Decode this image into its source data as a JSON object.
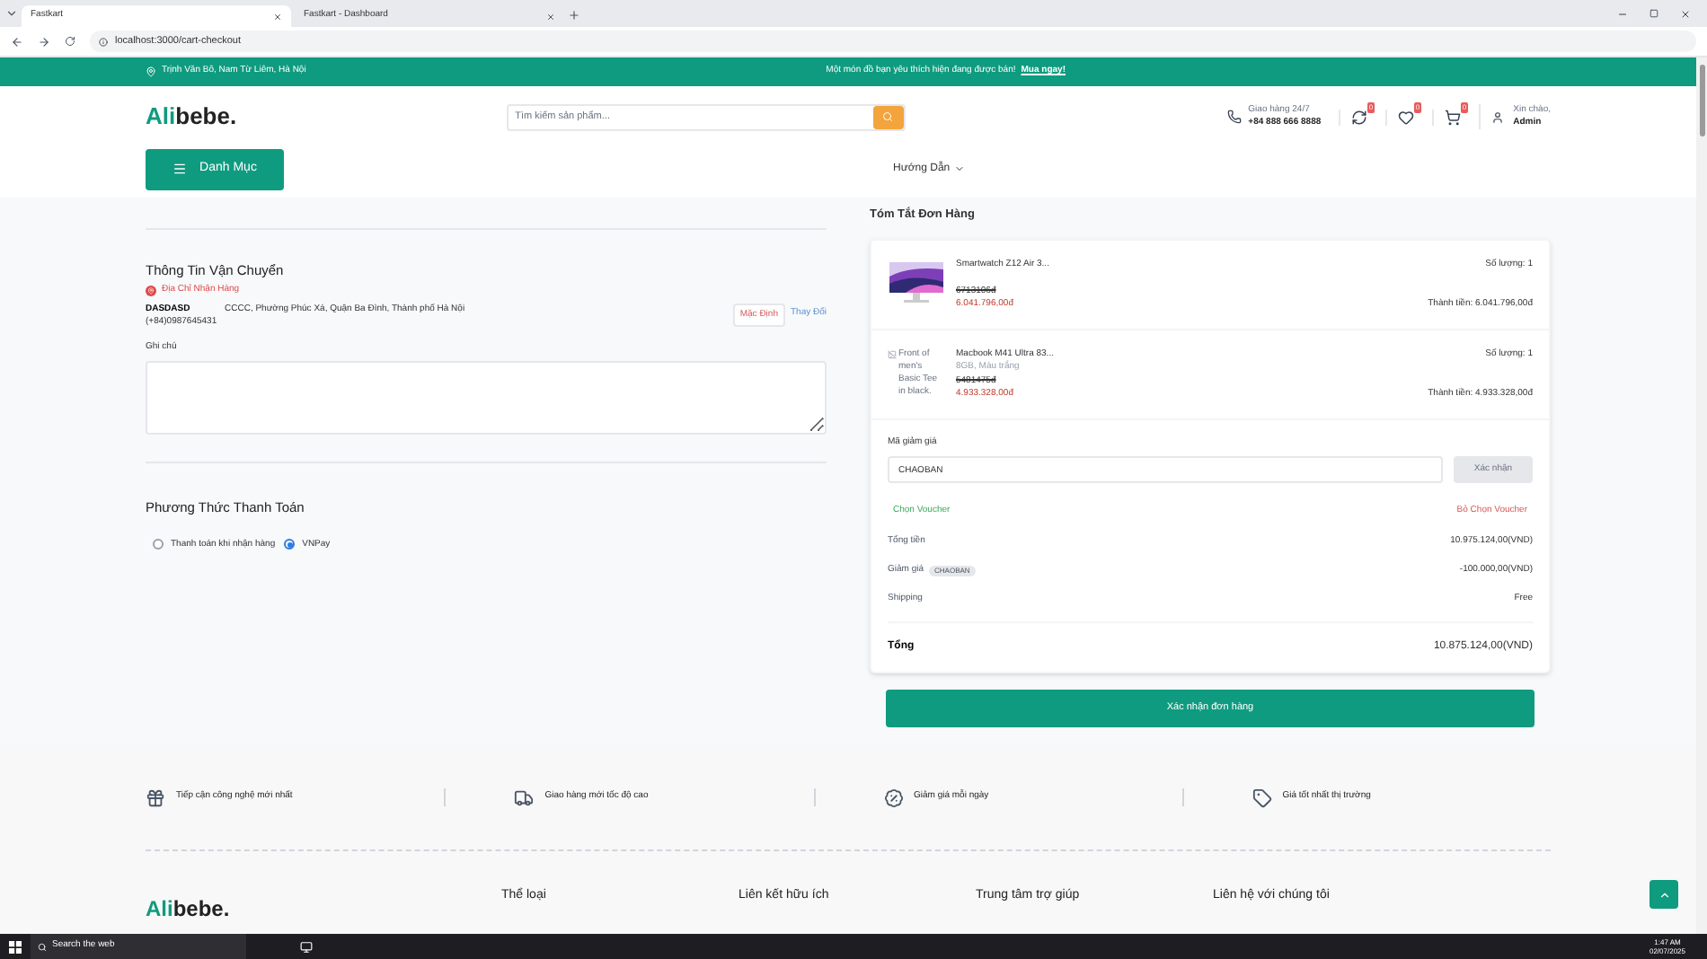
{
  "browser": {
    "tabs": [
      {
        "title": "Fastkart",
        "selected": true
      },
      {
        "title": "Fastkart - Dashboard",
        "selected": false
      }
    ],
    "url": "localhost:3000/cart-checkout"
  },
  "topbar": {
    "address": "Trịnh Văn Bô, Nam Từ Liêm, Hà Nội",
    "promo": "Một món đồ bạn yêu thích hiện đang được bán!",
    "promo_link": "Mua ngay!"
  },
  "header": {
    "logo_first": "Ali",
    "logo_second": "bebe.",
    "search_placeholder": "Tìm kiếm sản phẩm...",
    "hotline_label": "Giao hàng 24/7",
    "hotline_number": "+84 888 666 8888",
    "badges": [
      "0",
      "0",
      "0"
    ],
    "greeting": "Xin chào,",
    "user": "Admin",
    "category_button": "Danh Mục",
    "nav": "Hướng Dẫn"
  },
  "shipping": {
    "title": "Thông Tin Vận Chuyển",
    "address_label": "Địa Chỉ Nhận Hàng",
    "name": "DASDASD",
    "address": "CCCC, Phường Phúc Xá, Quận Ba Đình, Thành phố Hà Nội",
    "phone": "(+84)0987645431",
    "default_badge": "Mặc Định",
    "change_link": "Thay Đổi",
    "note_label": "Ghi chú"
  },
  "payment": {
    "title": "Phương Thức Thanh Toán",
    "options": [
      {
        "label": "Thanh toán khi nhận hàng",
        "selected": false
      },
      {
        "label": "VNPay",
        "selected": true
      }
    ]
  },
  "summary": {
    "title": "Tóm Tắt Đơn Hàng",
    "items": [
      {
        "name": "Smartwatch Z12 Air 3...",
        "old_price": "6713106đ",
        "price": "6.041.796,00đ",
        "quantity": "Số lượng: 1",
        "subtotal": "Thành tiền: 6.041.796,00đ"
      },
      {
        "image": {
          "kind": "broken",
          "alt": "Front of men's Basic Tee in black."
        },
        "name": "Macbook M41 Ultra 83...",
        "variant": "8GB, Màu trắng",
        "old_price": "5481475đ",
        "price": "4.933.328,00đ",
        "quantity": "Số lượng: 1",
        "subtotal": "Thành tiền: 4.933.328,00đ"
      }
    ],
    "coupon": {
      "label": "Mã giảm giá",
      "value": "CHAOBAN",
      "apply": "Xác nhận",
      "choose": "Chọn Voucher",
      "remove": "Bỏ Chọn Voucher"
    },
    "lines": [
      {
        "label": "Tổng tiền",
        "value": "10.975.124,00(VND)"
      },
      {
        "label": "Giảm giá",
        "tag": "CHAOBAN",
        "value": "-100.000,00(VND)"
      },
      {
        "label": "Shipping",
        "value": "Free"
      }
    ],
    "total": {
      "label": "Tổng",
      "value": "10.875.124,00(VND)"
    },
    "confirm": "Xác nhận đơn hàng"
  },
  "features": [
    {
      "kind": "gift",
      "text": "Tiếp cận công nghệ mới nhất"
    },
    {
      "kind": "truck",
      "text": "Giao hàng mới tốc độ cao"
    },
    {
      "kind": "percent",
      "text": "Giảm giá mỗi ngày"
    },
    {
      "kind": "tag",
      "text": "Giá tốt nhất thị trường"
    }
  ],
  "footer": {
    "logo_first": "Ali",
    "logo_second": "bebe.",
    "headings": [
      "Thể loại",
      "Liên kết hữu ích",
      "Trung tâm trợ giúp",
      "Liên hệ với chúng tôi"
    ]
  },
  "taskbar": {
    "search": "Search the web",
    "time": "1:47 AM",
    "date": "02/07/2025"
  }
}
